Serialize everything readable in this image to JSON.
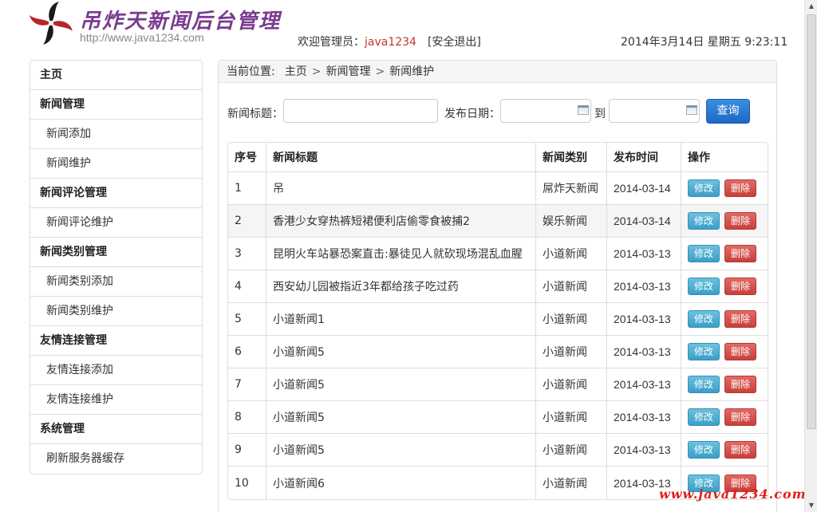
{
  "header": {
    "logo_title": "吊炸天新闻后台管理",
    "logo_url": "http://www.java1234.com",
    "welcome_prefix": "欢迎管理员：",
    "username": "java1234",
    "logout_label": "[安全退出]",
    "datetime": "2014年3月14日 星期五 9:23:11"
  },
  "sidebar": {
    "items": [
      {
        "label": "主页",
        "type": "group"
      },
      {
        "label": "新闻管理",
        "type": "group"
      },
      {
        "label": "新闻添加",
        "type": "child"
      },
      {
        "label": "新闻维护",
        "type": "child"
      },
      {
        "label": "新闻评论管理",
        "type": "group"
      },
      {
        "label": "新闻评论维护",
        "type": "child"
      },
      {
        "label": "新闻类别管理",
        "type": "group"
      },
      {
        "label": "新闻类别添加",
        "type": "child"
      },
      {
        "label": "新闻类别维护",
        "type": "child"
      },
      {
        "label": "友情连接管理",
        "type": "group"
      },
      {
        "label": "友情连接添加",
        "type": "child"
      },
      {
        "label": "友情连接维护",
        "type": "child"
      },
      {
        "label": "系统管理",
        "type": "group"
      },
      {
        "label": "刷新服务器缓存",
        "type": "child"
      }
    ]
  },
  "breadcrumb": {
    "prefix": "当前位置:",
    "items": [
      "主页",
      "新闻管理",
      "新闻维护"
    ],
    "separator": ">"
  },
  "search": {
    "title_label": "新闻标题：",
    "title_value": "",
    "date_label": "发布日期：",
    "date_from_value": "",
    "to_label": "到",
    "date_to_value": "",
    "query_label": "查询"
  },
  "table": {
    "headers": [
      "序号",
      "新闻标题",
      "新闻类别",
      "发布时间",
      "操作"
    ],
    "edit_label": "修改",
    "delete_label": "删除",
    "rows": [
      {
        "no": "1",
        "title": "吊",
        "category": "屌炸天新闻",
        "date": "2014-03-14"
      },
      {
        "no": "2",
        "title": "香港少女穿热裤短裙便利店偷零食被捕2",
        "category": "娱乐新闻",
        "date": "2014-03-14"
      },
      {
        "no": "3",
        "title": "昆明火车站暴恐案直击:暴徒见人就砍现场混乱血腥",
        "category": "小道新闻",
        "date": "2014-03-13"
      },
      {
        "no": "4",
        "title": "西安幼儿园被指近3年都给孩子吃过药",
        "category": "小道新闻",
        "date": "2014-03-13"
      },
      {
        "no": "5",
        "title": "小道新闻1",
        "category": "小道新闻",
        "date": "2014-03-13"
      },
      {
        "no": "6",
        "title": "小道新闻5",
        "category": "小道新闻",
        "date": "2014-03-13"
      },
      {
        "no": "7",
        "title": "小道新闻5",
        "category": "小道新闻",
        "date": "2014-03-13"
      },
      {
        "no": "8",
        "title": "小道新闻5",
        "category": "小道新闻",
        "date": "2014-03-13"
      },
      {
        "no": "9",
        "title": "小道新闻5",
        "category": "小道新闻",
        "date": "2014-03-13"
      },
      {
        "no": "10",
        "title": "小道新闻6",
        "category": "小道新闻",
        "date": "2014-03-13"
      }
    ]
  },
  "watermark": "www.java1234.com",
  "colors": {
    "logo_purple": "#7a3b8f",
    "username_red": "#c0392b",
    "query_blue": "#1d68c4",
    "edit_cyan": "#3a9fc8",
    "delete_red": "#c9403a",
    "watermark_red": "#e0201b"
  },
  "icons": {
    "logo": "pinwheel-logo-icon",
    "calendar": "calendar-icon"
  }
}
